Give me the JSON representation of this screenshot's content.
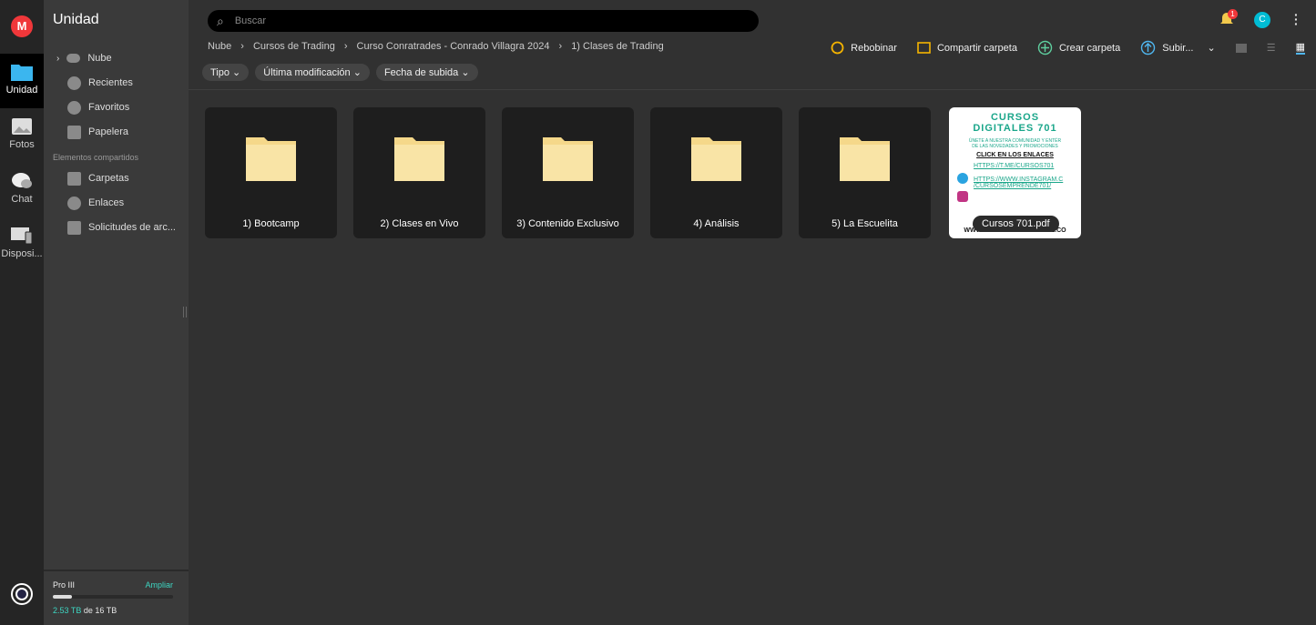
{
  "rail": {
    "logo": "M",
    "items": [
      {
        "label": "Unidad",
        "icon": "folder-icon"
      },
      {
        "label": "Fotos",
        "icon": "photo-icon"
      },
      {
        "label": "Chat",
        "icon": "chat-icon"
      },
      {
        "label": "Disposi...",
        "icon": "devices-icon"
      }
    ]
  },
  "sidebar": {
    "title": "Unidad",
    "items": [
      {
        "label": "Nube",
        "icon": "cloud-icon"
      },
      {
        "label": "Recientes",
        "icon": "clock-icon"
      },
      {
        "label": "Favoritos",
        "icon": "heart-icon"
      },
      {
        "label": "Papelera",
        "icon": "trash-icon"
      }
    ],
    "shared_title": "Elementos compartidos",
    "shared": [
      {
        "label": "Carpetas",
        "icon": "shared-folder-icon"
      },
      {
        "label": "Enlaces",
        "icon": "link-icon"
      },
      {
        "label": "Solicitudes de arc...",
        "icon": "file-request-icon"
      }
    ],
    "storage": {
      "plan": "Pro III",
      "upgrade": "Ampliar",
      "used": "2.53 TB",
      "of": "de 16 TB",
      "fraction": 0.158
    }
  },
  "header": {
    "search_placeholder": "Buscar",
    "notifications": "1",
    "avatar": "C"
  },
  "breadcrumb": [
    "Nube",
    "Cursos de Trading",
    "Curso Conratrades - Conrado Villagra 2024",
    "1) Clases de Trading"
  ],
  "actions": {
    "rewind": "Rebobinar",
    "share": "Compartir carpeta",
    "create": "Crear carpeta",
    "upload": "Subir..."
  },
  "filters": [
    "Tipo",
    "Última modificación",
    "Fecha de subida"
  ],
  "items": [
    {
      "name": "1) Bootcamp"
    },
    {
      "name": "2) Clases en Vivo"
    },
    {
      "name": "3) Contenido Exclusivo"
    },
    {
      "name": "4) Análisis"
    },
    {
      "name": "5) La Escuelita"
    }
  ],
  "pdf": {
    "name": "Cursos 701.pdf",
    "preview": {
      "title1": "CURSOS",
      "title2": "DIGITALES 701",
      "line1": "ÚNETE A NUESTRA COMUNIDAD Y ENTÉR",
      "line2": "DE LAS NOVEDADES Y PROMOCIONES",
      "cta": "CLICK EN LOS ENLACES",
      "link1": "HTTPS://T.ME/CURSOS701",
      "link2": "HTTPS://WWW.INSTAGRAM.C",
      "link3": "/CURSOSEMPRENDE701/",
      "footer": "WWW.CURSOSDIGITALES701.CO"
    }
  }
}
